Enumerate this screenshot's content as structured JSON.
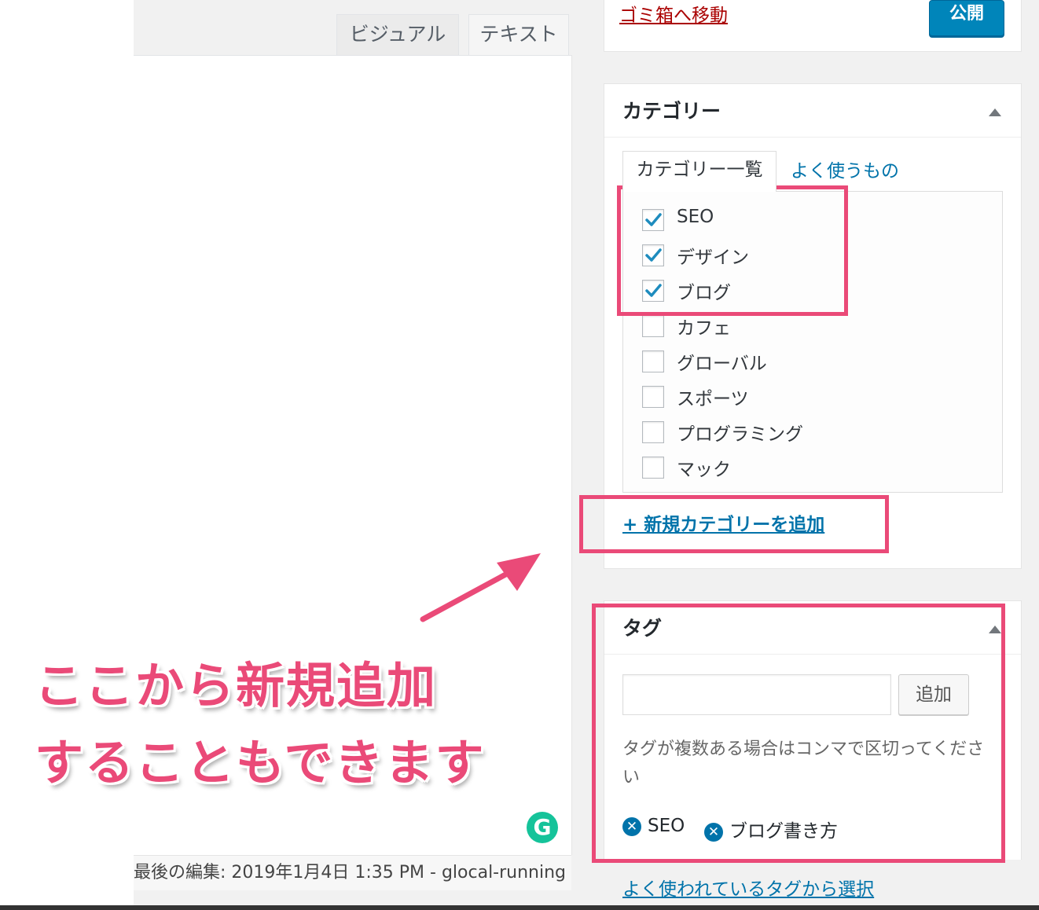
{
  "editor": {
    "tabs": [
      {
        "label": "ビジュアル",
        "active": false
      },
      {
        "label": "テキスト",
        "active": true
      }
    ],
    "status_text": "最後の編集: 2019年1月4日 1:35 PM - glocal-running",
    "grammarly_letter": "G"
  },
  "publish": {
    "trash_link": "ゴミ箱へ移動",
    "publish_button": "公開"
  },
  "category_box": {
    "title": "カテゴリー",
    "tabs": {
      "all": "カテゴリー一覧",
      "popular": "よく使うもの"
    },
    "items": [
      {
        "label": "SEO",
        "checked": true
      },
      {
        "label": "デザイン",
        "checked": true
      },
      {
        "label": "ブログ",
        "checked": true
      },
      {
        "label": "カフェ",
        "checked": false
      },
      {
        "label": "グローバル",
        "checked": false
      },
      {
        "label": "スポーツ",
        "checked": false
      },
      {
        "label": "プログラミング",
        "checked": false
      },
      {
        "label": "マック",
        "checked": false
      }
    ],
    "add_link": "+ 新規カテゴリーを追加"
  },
  "tag_box": {
    "title": "タグ",
    "input_value": "",
    "add_button": "追加",
    "help_text": "タグが複数ある場合はコンマで区切ってください",
    "tags": [
      "SEO",
      "ブログ書き方"
    ],
    "choose_link": "よく使われているタグから選択"
  },
  "annotation": {
    "line1": "ここから新規追加",
    "line2": "することもできます",
    "color": "#ea4a78"
  },
  "colors": {
    "link": "#0073aa",
    "primary_button": "#0085ba",
    "trash": "#a00",
    "highlight": "#ea4a78"
  }
}
